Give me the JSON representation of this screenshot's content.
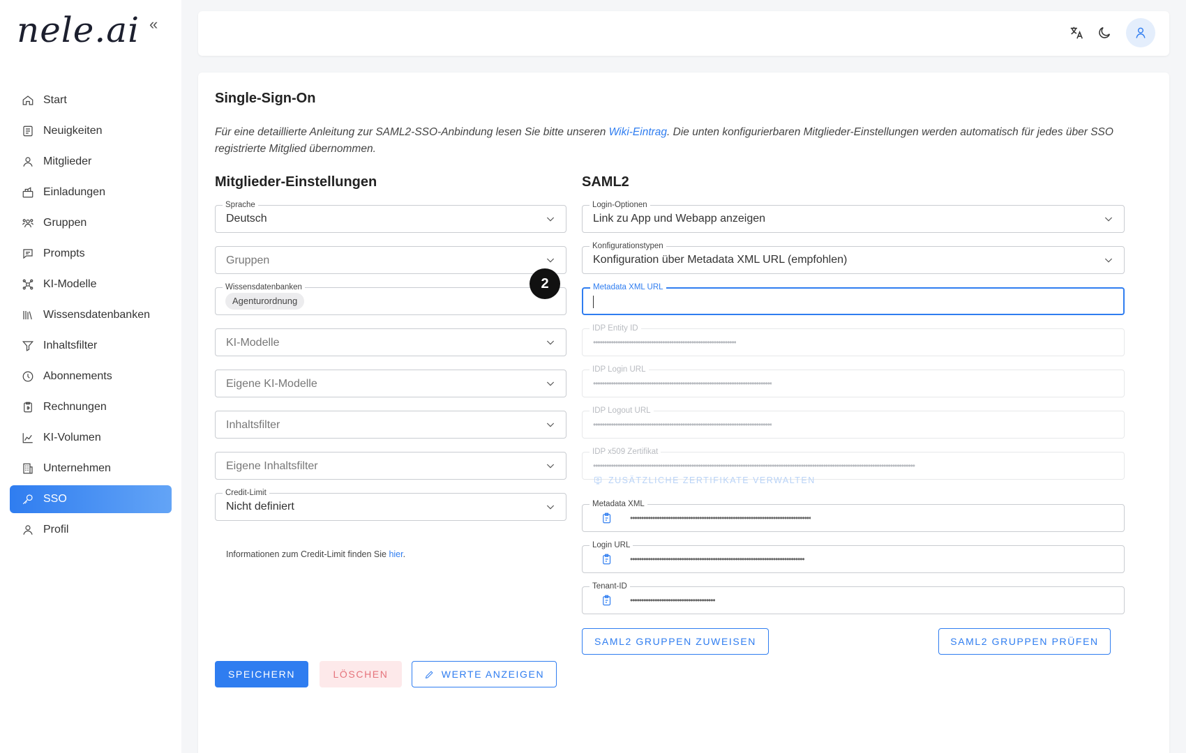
{
  "sidebar": {
    "logo": "nele.ai",
    "collapse_glyph": "«",
    "items": [
      {
        "label": "Start",
        "icon": "home-icon"
      },
      {
        "label": "Neuigkeiten",
        "icon": "news-icon"
      },
      {
        "label": "Mitglieder",
        "icon": "user-icon"
      },
      {
        "label": "Einladungen",
        "icon": "invitations-icon"
      },
      {
        "label": "Gruppen",
        "icon": "groups-icon"
      },
      {
        "label": "Prompts",
        "icon": "prompts-icon"
      },
      {
        "label": "KI-Modelle",
        "icon": "ai-models-icon"
      },
      {
        "label": "Wissensdatenbanken",
        "icon": "library-icon"
      },
      {
        "label": "Inhaltsfilter",
        "icon": "filter-icon"
      },
      {
        "label": "Abonnements",
        "icon": "clock-icon"
      },
      {
        "label": "Rechnungen",
        "icon": "invoice-icon"
      },
      {
        "label": "KI-Volumen",
        "icon": "chart-icon"
      },
      {
        "label": "Unternehmen",
        "icon": "company-icon"
      },
      {
        "label": "SSO",
        "icon": "key-icon"
      },
      {
        "label": "Profil",
        "icon": "profile-icon"
      }
    ],
    "active_item": "SSO"
  },
  "topbar": {
    "icons": [
      "translate-icon",
      "dark-mode-icon",
      "user-avatar-icon"
    ]
  },
  "page": {
    "title": "Single-Sign-On",
    "intro_before": "Für eine detaillierte Anleitung zur SAML2-SSO-Anbindung lesen Sie bitte unseren ",
    "intro_link": "Wiki-Eintrag",
    "intro_after": ". Die unten konfigurierbaren Mitglieder-Einstellungen werden automatisch für jedes über SSO registrierte Mitglied übernommen."
  },
  "members": {
    "title": "Mitglieder-Einstellungen",
    "sprache": {
      "label": "Sprache",
      "value": "Deutsch"
    },
    "gruppen": {
      "placeholder": "Gruppen"
    },
    "wissensdatenbanken": {
      "label": "Wissensdatenbanken",
      "chip": "Agenturordnung"
    },
    "ki_modelle": {
      "placeholder": "KI-Modelle"
    },
    "eigene_ki_modelle": {
      "placeholder": "Eigene KI-Modelle"
    },
    "inhaltsfilter": {
      "placeholder": "Inhaltsfilter"
    },
    "eigene_inhaltsfilter": {
      "placeholder": "Eigene Inhaltsfilter"
    },
    "credit_limit": {
      "label": "Credit-Limit",
      "value": "Nicht definiert"
    },
    "helper_before": "Informationen zum Credit-Limit finden Sie ",
    "helper_link": "hier",
    "helper_after": "."
  },
  "saml2": {
    "title": "SAML2",
    "login_optionen": {
      "label": "Login-Optionen",
      "value": "Link zu App und Webapp anzeigen"
    },
    "konfigurationstypen": {
      "label": "Konfigurationstypen",
      "value": "Konfiguration über Metadata XML URL (empfohlen)"
    },
    "metadata_xml_url": {
      "label": "Metadata XML URL",
      "value": ""
    },
    "idp_entity_id": {
      "label": "IDP Entity ID",
      "value": "••••••••••••••••••••••••••••••••••••••••••••••••••••••••••••••••"
    },
    "idp_login_url": {
      "label": "IDP Login URL",
      "value": "••••••••••••••••••••••••••••••••••••••••••••••••••••••••••••••••••••••••••••••••"
    },
    "idp_logout_url": {
      "label": "IDP Logout URL",
      "value": "••••••••••••••••••••••••••••••••••••••••••••••••••••••••••••••••••••••••••••••••"
    },
    "idp_x509": {
      "label": "IDP x509 Zertifikat",
      "value": "••••••••••••••••••••••••••••••••••••••••••••••••••••••••••••••••••••••••••••••••••••••••••••••••••••••••••••••••••••••••••••••••••••••••••••••••"
    },
    "manage_certs": "ZUSÄTZLICHE ZERTIFIKATE VERWALTEN",
    "metadata_xml": {
      "label": "Metadata XML",
      "value": "•••••••••••••••••••••••••••••••••••••••••••••••••••••••••••••••••••••••••••••••••"
    },
    "login_url": {
      "label": "Login URL",
      "value": "••••••••••••••••••••••••••••••••••••••••••••••••••••••••••••••••••••••••••••••"
    },
    "tenant_id": {
      "label": "Tenant-ID",
      "value": "••••••••••••••••••••••••••••••••••••••"
    },
    "assign_groups": "SAML2 GRUPPEN ZUWEISEN",
    "check_groups": "SAML2 GRUPPEN PRÜFEN"
  },
  "actions": {
    "save": "SPEICHERN",
    "delete": "LÖSCHEN",
    "show_values": "WERTE ANZEIGEN"
  },
  "annotation": {
    "step": "2"
  },
  "colors": {
    "accent": "#2f7df0",
    "danger_bg": "#fde9ea",
    "danger_text": "#e5737b"
  }
}
